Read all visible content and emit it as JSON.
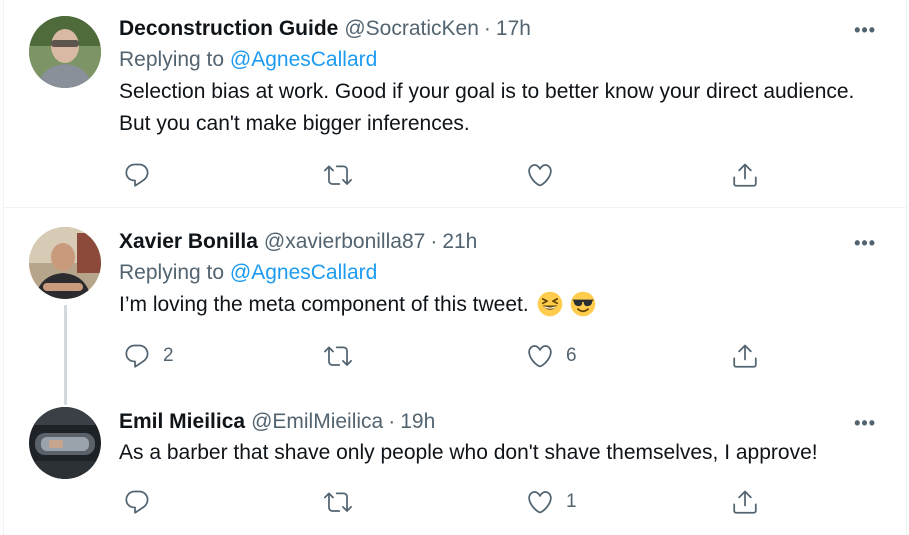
{
  "tweets": [
    {
      "name": "Deconstruction Guide",
      "handle": "@SocraticKen",
      "dot": "·",
      "time": "17h",
      "replying_prefix": "Replying to",
      "replying_to": "@AgnesCallard",
      "text": "Selection bias at work. Good if your goal is to better know your direct audience. But you can't make bigger inferences.",
      "more": "•••",
      "reply_count": "",
      "retweet_count": "",
      "like_count": ""
    },
    {
      "name": "Xavier Bonilla",
      "handle": "@xavierbonilla87",
      "dot": "·",
      "time": "21h",
      "replying_prefix": "Replying to",
      "replying_to": "@AgnesCallard",
      "text": "I’m loving the meta component of this tweet.",
      "emojis": [
        "grinning-squinting-face",
        "smiling-face-with-sunglasses"
      ],
      "more": "•••",
      "reply_count": "2",
      "retweet_count": "",
      "like_count": "6"
    },
    {
      "name": "Emil Mieilica",
      "handle": "@EmilMieilica",
      "dot": "·",
      "time": "19h",
      "text": "As a barber that shave only people who don't shave themselves, I approve!",
      "more": "•••",
      "reply_count": "",
      "retweet_count": "",
      "like_count": "1"
    }
  ],
  "icons": {
    "reply": "reply-icon",
    "retweet": "retweet-icon",
    "like": "heart-icon",
    "share": "share-icon",
    "more": "more-icon"
  },
  "colors": {
    "text": "#0f1419",
    "secondary": "#536471",
    "link": "#1d9bf0",
    "border": "#eff3f4",
    "thread": "#cfd9de"
  }
}
